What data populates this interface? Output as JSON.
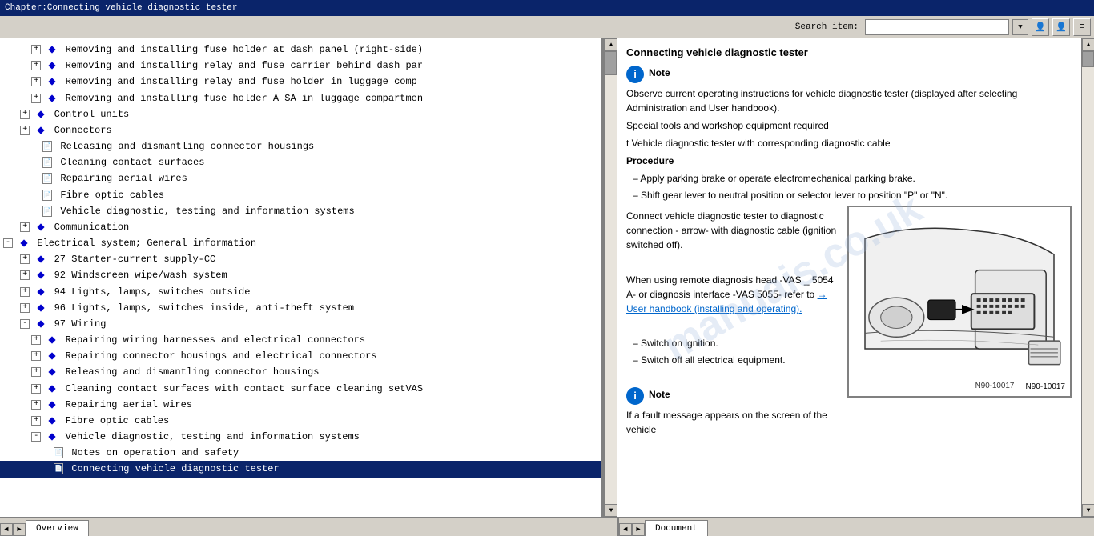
{
  "titleBar": {
    "text": "Chapter:Connecting vehicle diagnostic tester"
  },
  "toolbar": {
    "searchLabel": "Search item:",
    "searchPlaceholder": "",
    "buttons": [
      "⟨⟨",
      "⟩⟩",
      "≡"
    ]
  },
  "leftPanel": {
    "items": [
      {
        "level": 2,
        "type": "expand-blue",
        "text": "Removing and installing fuse holder at dash panel (right-side)",
        "expanded": false
      },
      {
        "level": 2,
        "type": "expand-blue",
        "text": "Removing and installing relay and fuse carrier behind dash par",
        "expanded": false
      },
      {
        "level": 2,
        "type": "expand-blue",
        "text": "Removing and installing relay and fuse holder in luggage comp",
        "expanded": false
      },
      {
        "level": 2,
        "type": "expand-blue",
        "text": "Removing and installing fuse holder A SA in luggage compartmen",
        "expanded": false
      },
      {
        "level": 1,
        "type": "expand-blue",
        "text": "Control units",
        "expanded": false
      },
      {
        "level": 1,
        "type": "expand-blue",
        "text": "Connectors",
        "expanded": true
      },
      {
        "level": 2,
        "type": "doc",
        "text": "Releasing and dismantling connector housings"
      },
      {
        "level": 2,
        "type": "doc",
        "text": "Cleaning contact surfaces"
      },
      {
        "level": 2,
        "type": "doc",
        "text": "Repairing aerial wires"
      },
      {
        "level": 2,
        "type": "doc",
        "text": "Fibre optic cables"
      },
      {
        "level": 2,
        "type": "doc",
        "text": "Vehicle diagnostic, testing and information systems"
      },
      {
        "level": 1,
        "type": "expand-blue",
        "text": "Communication",
        "expanded": false
      },
      {
        "level": 1,
        "type": "expand-open",
        "text": "Electrical system; General information",
        "expanded": true
      },
      {
        "level": 2,
        "type": "expand-blue",
        "text": "27 Starter-current supply-CC",
        "expanded": false
      },
      {
        "level": 2,
        "type": "expand-blue",
        "text": "92 Windscreen wipe/wash system",
        "expanded": false
      },
      {
        "level": 2,
        "type": "expand-blue",
        "text": "94 Lights, lamps, switches outside",
        "expanded": false
      },
      {
        "level": 2,
        "type": "expand-blue",
        "text": "96 Lights, lamps, switches inside, anti-theft system",
        "expanded": false
      },
      {
        "level": 2,
        "type": "expand-open",
        "text": "97 Wiring",
        "expanded": true
      },
      {
        "level": 3,
        "type": "expand-blue",
        "text": "Repairing wiring harnesses and electrical connectors",
        "expanded": false
      },
      {
        "level": 3,
        "type": "expand-blue",
        "text": "Repairing connector housings and electrical connectors",
        "expanded": false
      },
      {
        "level": 3,
        "type": "expand-blue",
        "text": "Releasing and dismantling connector housings",
        "expanded": false
      },
      {
        "level": 3,
        "type": "expand-blue",
        "text": "Cleaning contact surfaces with contact surface cleaning setVAS",
        "expanded": false
      },
      {
        "level": 3,
        "type": "expand-blue",
        "text": "Repairing aerial wires",
        "expanded": false
      },
      {
        "level": 3,
        "type": "expand-blue",
        "text": "Fibre optic cables",
        "expanded": false
      },
      {
        "level": 3,
        "type": "expand-open",
        "text": "Vehicle diagnostic, testing and information systems",
        "expanded": true
      },
      {
        "level": 4,
        "type": "doc",
        "text": "Notes on operation and safety"
      },
      {
        "level": 4,
        "type": "doc",
        "text": "Connecting vehicle diagnostic tester",
        "selected": true
      }
    ]
  },
  "rightPanel": {
    "title": "Connecting vehicle diagnostic tester",
    "noteLabel": "Note",
    "noteText1": "Observe current operating instructions for vehicle diagnostic tester (displayed after selecting Administration and User handbook).",
    "specialTools": "Special tools and workshop equipment required",
    "toolItem": "t  Vehicle diagnostic tester with corresponding diagnostic cable",
    "procedure": "Procedure",
    "steps": [
      "Apply parking brake or operate electromechanical parking brake.",
      "Shift gear lever to neutral position or selector lever to position \"P\" or \"N\"."
    ],
    "connectText": "Connect vehicle diagnostic tester to diagnostic connection - arrow- with diagnostic cable (ignition switched off).",
    "remoteText": "When using remote diagnosis head -VAS _ 5054 A- or diagnosis interface -VAS 5055- refer to",
    "linkText": "→ User handbook (installing and operating).",
    "switchOn": "– Switch on ignition.",
    "switchOff": "– Switch off all electrical equipment.",
    "note2Label": "Note",
    "note2Text": "If a fault message appears on the screen of the vehicle",
    "diagramLabel": "N90-10017",
    "arrowText": "arrow - With diagnostic"
  },
  "tabs": {
    "left": "Overview",
    "right": "Document"
  },
  "watermark": "manuais.co.uk"
}
